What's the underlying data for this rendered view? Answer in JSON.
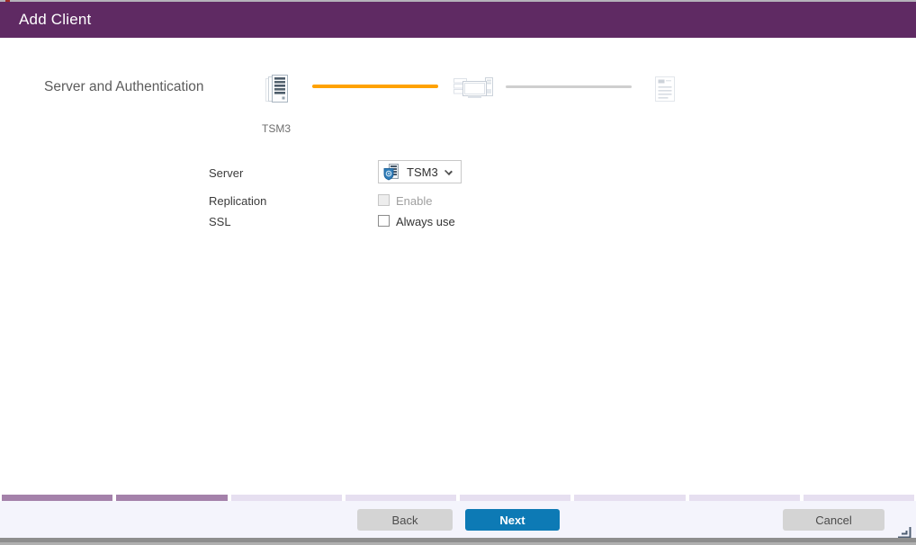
{
  "titlebar": {
    "title": "Add Client",
    "bg_color": "#5f2a63"
  },
  "wizard": {
    "heading": "Server and Authentication",
    "steps": [
      {
        "name": "server-and-authentication",
        "icon": "server-icon",
        "state": "current",
        "label": "TSM3"
      },
      {
        "name": "client-details",
        "icon": "client-devices-icon",
        "state": "upcoming",
        "label": ""
      },
      {
        "name": "summary",
        "icon": "summary-document-icon",
        "state": "upcoming",
        "label": ""
      }
    ],
    "connectors": [
      {
        "state": "active",
        "color": "#ffa200"
      },
      {
        "state": "inactive",
        "color": "#cfcfcf"
      }
    ]
  },
  "form": {
    "server": {
      "label": "Server",
      "value": "TSM3",
      "control": "dropdown",
      "icon": "server-shield-icon"
    },
    "replication": {
      "label": "Replication",
      "option_label": "Enable",
      "checked": false,
      "disabled": true
    },
    "ssl": {
      "label": "SSL",
      "option_label": "Always use",
      "checked": false,
      "disabled": false
    }
  },
  "progress_tabs": {
    "segment_count": 8,
    "completed_count": 2,
    "completed_color": "#a481aa",
    "remaining_color": "#e6dff0"
  },
  "footer": {
    "back_label": "Back",
    "next_label": "Next",
    "cancel_label": "Cancel",
    "next_button_color": "#0d7ab5",
    "gray_button_color": "#d4d4d4",
    "bg_color": "#f4f4fc"
  }
}
